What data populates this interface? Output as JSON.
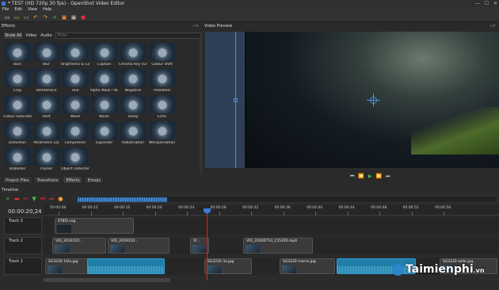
{
  "window": {
    "title": "* TEST (HD 720p 30 fps) - OpenShot Video Editor"
  },
  "menu": [
    "File",
    "Edit",
    "View",
    "Help"
  ],
  "toolbar": {
    "icons": [
      {
        "name": "new-project-icon",
        "glyph": "▭",
        "color": "#cfd8dc"
      },
      {
        "name": "open-project-icon",
        "glyph": "▭",
        "color": "#8bc34a"
      },
      {
        "name": "save-project-icon",
        "glyph": "▭",
        "color": "#9e9e9e"
      },
      {
        "name": "undo-icon",
        "glyph": "↶",
        "color": "#f0a030"
      },
      {
        "name": "redo-icon",
        "glyph": "↷",
        "color": "#f0a030"
      },
      {
        "name": "import-files-icon",
        "glyph": "+",
        "color": "#43c043"
      },
      {
        "name": "choose-profile-icon",
        "glyph": "▣",
        "color": "#f08a3a"
      },
      {
        "name": "fullscreen-icon",
        "glyph": "▣",
        "color": "#bbbbbb"
      },
      {
        "name": "export-video-icon",
        "glyph": "●",
        "color": "#e03030"
      }
    ]
  },
  "effects": {
    "title": "Effects",
    "tabs": [
      "Show All",
      "Video",
      "Audio"
    ],
    "filter_placeholder": "Filter",
    "items": [
      "Bars",
      "Blur",
      "Brightness & Co...",
      "Caption",
      "Chroma Key (Gr...",
      "Colour Shift",
      "Crop",
      "Deinterlace",
      "Hue",
      "Alpha Mask / W...",
      "Negative",
      "Pixelated",
      "Colour Saturation",
      "Shift",
      "Wave",
      "Noise",
      "Delay",
      "Echo",
      "Distortion",
      "Parametric EQ",
      "Compressor",
      "Expander",
      "Robotisation",
      "Whisperisation",
      "Stabilizer",
      "Tracker",
      "Object Detector"
    ]
  },
  "bottom_tabs": [
    "Project Files",
    "Transitions",
    "Effects",
    "Emojis"
  ],
  "preview": {
    "title": "Video Preview",
    "controls": [
      "⏮",
      "⏪",
      "▶",
      "⏩",
      "⏭"
    ]
  },
  "timeline": {
    "title": "Timeline",
    "timecode": "00:00:20,24",
    "toolbar_icons": [
      {
        "name": "add-track-icon",
        "glyph": "+",
        "color": "#43c043"
      },
      {
        "name": "snap-icon",
        "glyph": "▬",
        "color": "#e03030"
      },
      {
        "name": "razor-icon",
        "glyph": "✂",
        "color": "#e03030"
      },
      {
        "name": "add-marker-icon",
        "glyph": "▼",
        "color": "#43c043"
      },
      {
        "name": "previous-marker-icon",
        "glyph": "⏮",
        "color": "#e03030"
      },
      {
        "name": "next-marker-icon",
        "glyph": "⏭",
        "color": "#e03030"
      },
      {
        "name": "center-playhead-icon",
        "glyph": "●",
        "color": "#f0a030"
      }
    ],
    "ruler": [
      "00:00:08",
      "00:00:12",
      "00:00:16",
      "00:00:20",
      "00:00:24",
      "00:00:28",
      "00:00:32",
      "00:00:36",
      "00:00:40",
      "00:00:44",
      "00:00:48",
      "00:00:52",
      "00:00:56"
    ],
    "tracks": [
      {
        "label": "Track 3",
        "clips": [
          {
            "name": "9T8f3.svg",
            "type": "grey"
          }
        ]
      },
      {
        "label": "Track 2",
        "clips": [
          {
            "name": "VID_2019110...",
            "type": "grey"
          },
          {
            "name": "VID_2019110...",
            "type": "grey"
          },
          {
            "name": "VI...",
            "type": "grey"
          },
          {
            "name": "VID_20200710_155350.mp4",
            "type": "grey"
          }
        ]
      },
      {
        "label": "Track 1",
        "clips": [
          {
            "name": "SG3220 1tile.jpg",
            "type": "grey"
          },
          {
            "name": "",
            "type": "blue"
          },
          {
            "name": "SG3220 3a.jpg",
            "type": "grey"
          },
          {
            "name": "SG3220 macro.jpg",
            "type": "grey"
          },
          {
            "name": "",
            "type": "blue"
          },
          {
            "name": "SG3220 wide.jpg",
            "type": "grey"
          }
        ]
      }
    ]
  },
  "watermark": {
    "brand": "Taimienphi",
    ".vn": ".vn"
  }
}
